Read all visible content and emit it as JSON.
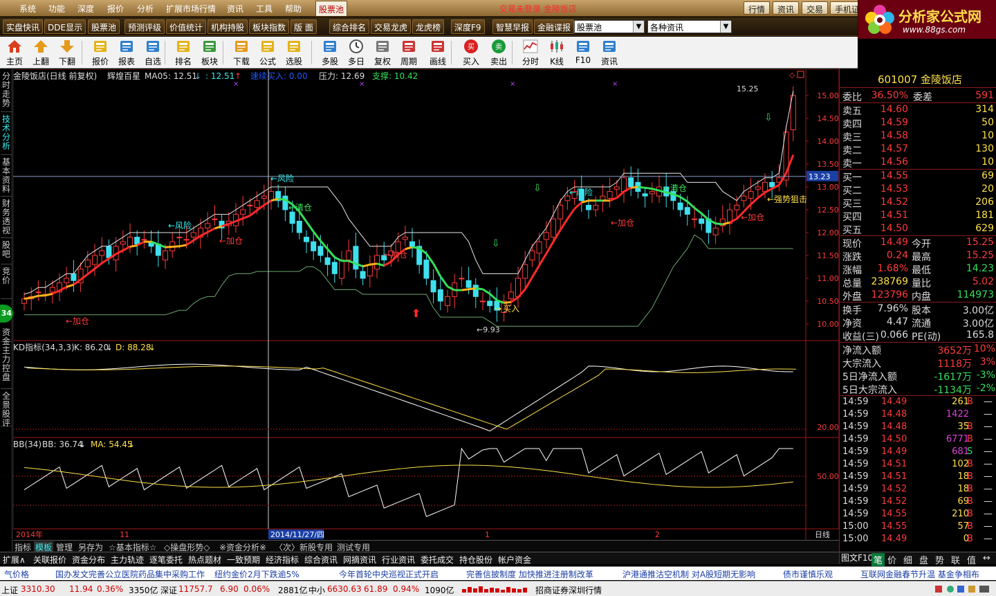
{
  "menubar": {
    "items": [
      "系统",
      "功能",
      "深度",
      "报价",
      "分析",
      "扩展市场行情",
      "资讯",
      "工具",
      "帮助",
      "股票池"
    ],
    "active_index": 9,
    "center_title": "交易未登录    金陵饭店",
    "right_buttons": [
      "行情",
      "资讯",
      "交易",
      "手机证"
    ]
  },
  "logo": {
    "title": "分析家公式网",
    "url_text": "www.88gs.com"
  },
  "featbar": {
    "buttons": [
      "实盘快讯",
      "DDE显示",
      "股票池",
      "预测评级",
      "价值统计",
      "机构持股",
      "板块指数",
      "版 面",
      "综合排名",
      "交易龙虎",
      "龙虎榜",
      "深度F9",
      "智慧早报",
      "金融谍报"
    ],
    "select1": "股票池",
    "select2": "各种资讯"
  },
  "iconbar": {
    "tools": [
      "主页",
      "上翻",
      "下翻",
      "报价",
      "报表",
      "自选",
      "排名",
      "板块",
      "下载",
      "公式",
      "选股",
      "多股",
      "多日",
      "复权",
      "周期",
      "画线",
      "买入",
      "卖出",
      "分时",
      "K线",
      "F10",
      "资讯"
    ]
  },
  "lefttabs": [
    "分时走势",
    "技术分析",
    "基本资料",
    "财务透视",
    "股吧",
    "竞价",
    "资金",
    "主力控盘",
    "全景股评"
  ],
  "badge": "34",
  "chart": {
    "stock_title": "金陵饭店(日线 前复权)",
    "indicator_name": "辉煌百星",
    "ma05_label": "MA05: 12.51",
    "ma05_b": ": 12.51",
    "upgrade_label": "速续买入: 0.00",
    "pressure_label": "压力: 12.69",
    "support_label": "支撑: 10.42",
    "price_ticks": [
      "15.00",
      "14.50",
      "14.00",
      "13.50",
      "13.00",
      "12.50",
      "12.00",
      "11.50",
      "11.00",
      "10.50",
      "10.00"
    ],
    "current_price_tag": "13.23",
    "high_label": "15.25",
    "low_label": "9.93",
    "annotations": {
      "risk1": "←风险",
      "risk2": "←风险",
      "risk3": "←风险",
      "clear1": "←清仓",
      "clear2": "←清仓",
      "add1": "←加仓",
      "add2": "←加仓",
      "add3": "←加仓",
      "add4": "←加仓",
      "add5": "←加仓",
      "add6": "←加仓",
      "buy": "买入",
      "strong": "←强势狙击"
    },
    "kd_title": "KD指标(34,3,3)",
    "kd_k": "K: 86.20",
    "kd_d": "D: 88.28",
    "kd_tick": "20.00",
    "bb_title": "BB(34)",
    "bb_val": "BB: 36.74",
    "bb_ma": "MA: 54.45",
    "bb_tick": "50.00",
    "date_labels": {
      "year": "2014年",
      "m11": "11",
      "cursor_date": "2014/11/27/四",
      "m1": "1",
      "m2": "2",
      "period": "日线"
    }
  },
  "chart_tabs": [
    "指标",
    "模板",
    "管理",
    "另存为",
    "☆基本指标☆",
    "◇操盘形势◇",
    "※资金分析※",
    "〈次〉新股专用",
    "测试专用"
  ],
  "chart_tabs_active": 1,
  "tabs2": [
    "扩展∧",
    "关联报价",
    "资金分布",
    "主力轨迹",
    "逐笔委托",
    "热点题材",
    "一致预期",
    "经济指标",
    "综合资讯",
    "网摘资讯",
    "行业资讯",
    "委托成交",
    "持仓股份",
    "帐户资金"
  ],
  "ticker": [
    "气价格",
    "国办发文完善公立医院药品集中采购工作",
    "纽约金价2月下跌逾5%",
    "今年首轮中央巡视正式开启",
    "完善信披制度 加快推进注册制改革",
    "沪港通推沽空机制 对A股短期无影响",
    "债市谨慎乐观",
    "互联网金融春节升温 基金争相布"
  ],
  "status": {
    "sh_label": "上证",
    "sh_val": "3310.30",
    "sh_chg": "11.94",
    "sh_pct": "0.36%",
    "sh_amt": "3350亿",
    "sz_label": "深证",
    "sz_val": "11757.7",
    "sz_chg": "6.90",
    "sz_pct": "0.06%",
    "sz_amt": "2881亿",
    "zx_label": "中小",
    "zx_val": "6630.63",
    "zx_chg": "61.89",
    "zx_pct": "0.94%",
    "zx_amt": "1090亿",
    "broker": "招商证券深圳行情"
  },
  "quote": {
    "code_name": "601007 金陵饭店",
    "weibi_label": "委比",
    "weibi_val": "36.50%",
    "weicha_label": "委差",
    "weicha_val": "591",
    "asks": [
      {
        "label": "卖五",
        "price": "14.60",
        "vol": "314"
      },
      {
        "label": "卖四",
        "price": "14.59",
        "vol": "50"
      },
      {
        "label": "卖三",
        "price": "14.58",
        "vol": "10"
      },
      {
        "label": "卖二",
        "price": "14.57",
        "vol": "130"
      },
      {
        "label": "卖一",
        "price": "14.56",
        "vol": "10"
      }
    ],
    "bids": [
      {
        "label": "买一",
        "price": "14.55",
        "vol": "69"
      },
      {
        "label": "买二",
        "price": "14.53",
        "vol": "20"
      },
      {
        "label": "买三",
        "price": "14.52",
        "vol": "206"
      },
      {
        "label": "买四",
        "price": "14.51",
        "vol": "181"
      },
      {
        "label": "买五",
        "price": "14.50",
        "vol": "629"
      }
    ],
    "stats": [
      {
        "l1": "现价",
        "v1": "14.49",
        "l2": "今开",
        "v2": "15.25"
      },
      {
        "l1": "涨跌",
        "v1": "0.24",
        "l2": "最高",
        "v2": "15.25"
      },
      {
        "l1": "涨幅",
        "v1": "1.68%",
        "l2": "最低",
        "v2": "14.23"
      },
      {
        "l1": "总量",
        "v1": "238769",
        "l2": "量比",
        "v2": "5.02"
      },
      {
        "l1": "外盘",
        "v1": "123796",
        "l2": "内盘",
        "v2": "114973"
      }
    ],
    "stats2": [
      {
        "l1": "换手",
        "v1": "7.96%",
        "l2": "股本",
        "v2": "3.00亿"
      },
      {
        "l1": "净资",
        "v1": "4.47",
        "l2": "流通",
        "v2": "3.00亿"
      },
      {
        "l1": "收益(三)",
        "v1": "0.066",
        "l2": "PE(动)",
        "v2": "165.8"
      }
    ],
    "flows": [
      {
        "label": "净流入额",
        "val": "3652万",
        "pct": "10%"
      },
      {
        "label": "大宗流入",
        "val": "1118万",
        "pct": "3%"
      },
      {
        "label": "5日净流入额",
        "val": "-1617万",
        "pct": "-3%"
      },
      {
        "label": "5日大宗流入",
        "val": "-1134万",
        "pct": "-2%"
      }
    ],
    "ticks": [
      {
        "t": "14:59",
        "p": "14.49",
        "v": "261",
        "s": "B",
        "vc": "#ffe14a"
      },
      {
        "t": "14:59",
        "p": "14.48",
        "v": "1422",
        "s": "",
        "vc": "#e040e0"
      },
      {
        "t": "14:59",
        "p": "14.48",
        "v": "35",
        "s": "B",
        "vc": "#ffe14a"
      },
      {
        "t": "14:59",
        "p": "14.50",
        "v": "6771",
        "s": "B",
        "vc": "#e040e0"
      },
      {
        "t": "14:59",
        "p": "14.49",
        "v": "681",
        "s": "S",
        "vc": "#e040e0"
      },
      {
        "t": "14:59",
        "p": "14.51",
        "v": "102",
        "s": "B",
        "vc": "#ffe14a"
      },
      {
        "t": "14:59",
        "p": "14.51",
        "v": "18",
        "s": "B",
        "vc": "#ffe14a"
      },
      {
        "t": "14:59",
        "p": "14.52",
        "v": "18",
        "s": "B",
        "vc": "#ffe14a"
      },
      {
        "t": "14:59",
        "p": "14.52",
        "v": "69",
        "s": "B",
        "vc": "#ffe14a"
      },
      {
        "t": "14:59",
        "p": "14.55",
        "v": "210",
        "s": "B",
        "vc": "#ffe14a"
      },
      {
        "t": "15:00",
        "p": "14.55",
        "v": "57",
        "s": "B",
        "vc": "#ffe14a"
      },
      {
        "t": "15:00",
        "p": "14.49",
        "v": "0",
        "s": "B",
        "vc": "#ffe14a"
      }
    ],
    "bottom_tabs": [
      "笔",
      "价",
      "细",
      "盘",
      "势",
      "联",
      "值",
      "↔"
    ],
    "bottom_left": "图文F10"
  }
}
